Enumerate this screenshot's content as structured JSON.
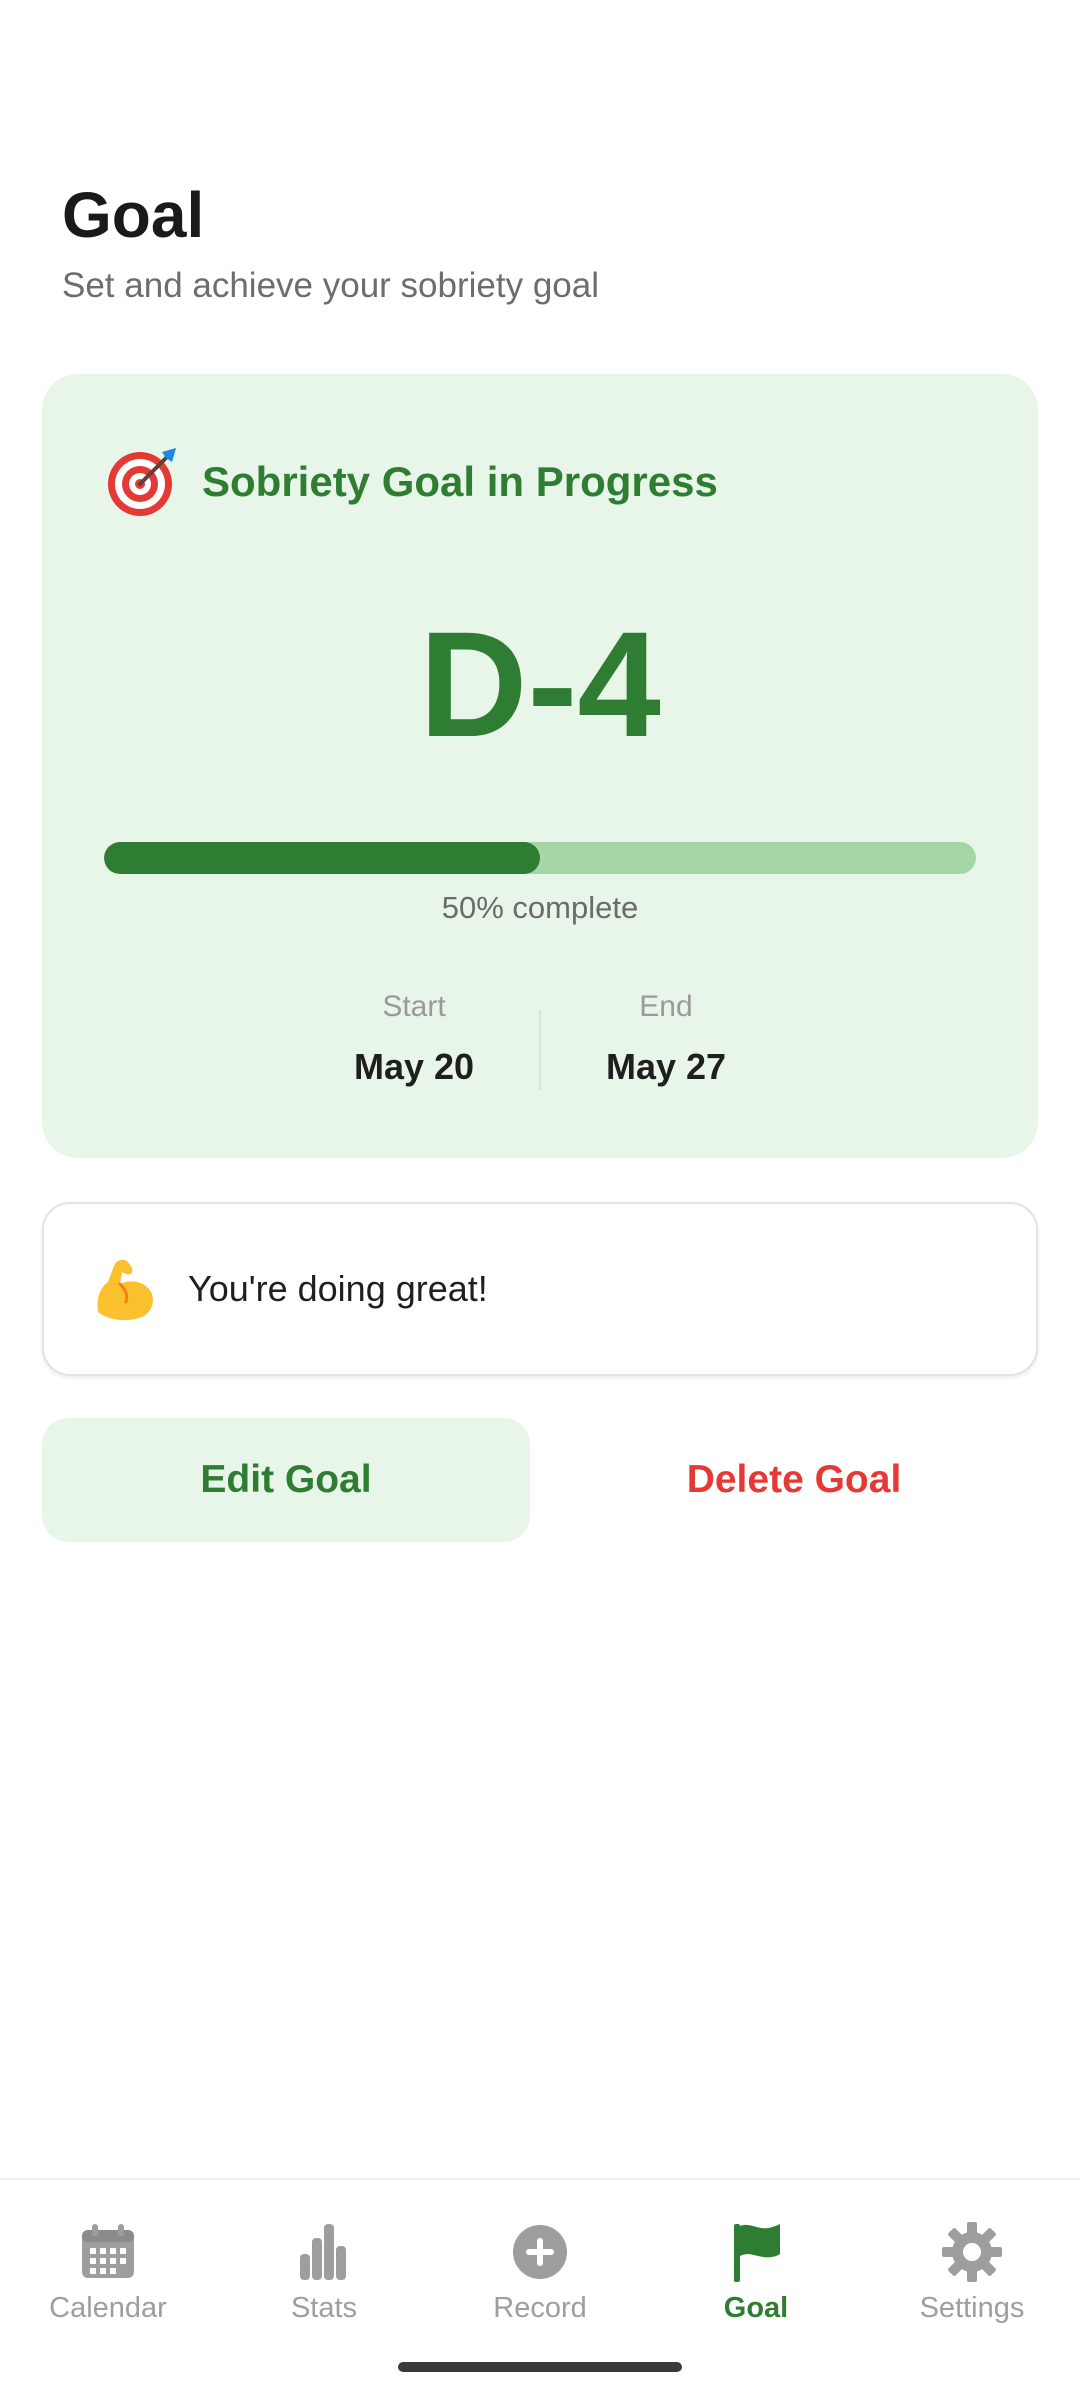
{
  "header": {
    "title": "Goal",
    "subtitle": "Set and achieve your sobriety goal"
  },
  "goal_card": {
    "icon": "target-icon",
    "title": "Sobriety Goal in Progress",
    "countdown": "D-4",
    "progress_fraction": 0.5,
    "progress_label": "50% complete",
    "start_label": "Start",
    "start_value": "May 20",
    "end_label": "End",
    "end_value": "May 27"
  },
  "encouragement": {
    "icon": "flexed-biceps-icon",
    "text": "You're doing great!"
  },
  "actions": {
    "edit_label": "Edit Goal",
    "delete_label": "Delete Goal"
  },
  "bottom_nav": {
    "items": [
      {
        "label": "Calendar",
        "icon": "calendar-icon",
        "active": false
      },
      {
        "label": "Stats",
        "icon": "bar-chart-icon",
        "active": false
      },
      {
        "label": "Record",
        "icon": "add-circle-icon",
        "active": false
      },
      {
        "label": "Goal",
        "icon": "flag-icon",
        "active": true
      },
      {
        "label": "Settings",
        "icon": "gear-icon",
        "active": false
      }
    ]
  },
  "colors": {
    "accent_green": "#2e7d32",
    "card_background": "#e8f5e9",
    "progress_track": "#a5d6a7",
    "danger_red": "#e53935",
    "inactive_gray": "#9e9e9e"
  }
}
